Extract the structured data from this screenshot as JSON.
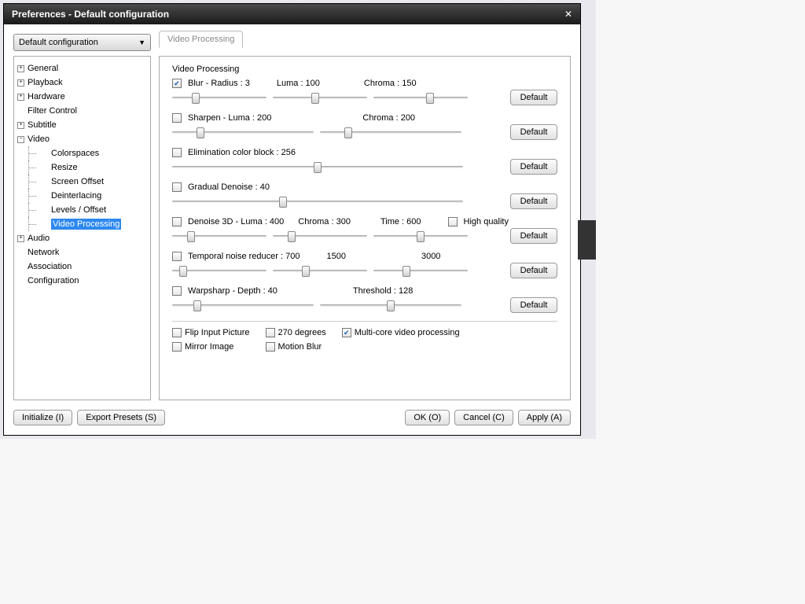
{
  "window_title": "Preferences - Default configuration",
  "combo_value": "Default configuration",
  "active_tab": "Video Processing",
  "tree": {
    "root": [
      {
        "label": "General",
        "kind": "plus"
      },
      {
        "label": "Playback",
        "kind": "plus"
      },
      {
        "label": "Hardware",
        "kind": "plus"
      },
      {
        "label": "Filter Control",
        "kind": "none"
      },
      {
        "label": "Subtitle",
        "kind": "plus"
      },
      {
        "label": "Video",
        "kind": "minus",
        "children": [
          "Colorspaces",
          "Resize",
          "Screen Offset",
          "Deinterlacing",
          "Levels / Offset",
          "Video Processing"
        ]
      },
      {
        "label": "Audio",
        "kind": "plus"
      },
      {
        "label": "Network",
        "kind": "none"
      },
      {
        "label": "Association",
        "kind": "none"
      },
      {
        "label": "Configuration",
        "kind": "none"
      }
    ],
    "selected": "Video Processing"
  },
  "section_title": "Video Processing",
  "default_label": "Default",
  "controls": {
    "blur": {
      "checked": true,
      "label": "Blur - Radius : 3",
      "luma": "Luma : 100",
      "chroma": "Chroma : 150"
    },
    "sharpen": {
      "checked": false,
      "label": "Sharpen - Luma : 200",
      "chroma": "Chroma : 200"
    },
    "elim": {
      "checked": false,
      "label": "Elimination color block : 256"
    },
    "grad": {
      "checked": false,
      "label": "Gradual Denoise : 40"
    },
    "d3d": {
      "checked": false,
      "label": "Denoise 3D - Luma : 400",
      "chroma": "Chroma : 300",
      "time": "Time : 600",
      "hq": "High quality",
      "hq_checked": false
    },
    "tnr": {
      "checked": false,
      "label": "Temporal noise reducer : 700",
      "v2": "1500",
      "v3": "3000"
    },
    "warp": {
      "checked": false,
      "label": "Warpsharp - Depth : 40",
      "thr": "Threshold : 128"
    },
    "flip": {
      "checked": false,
      "label": "Flip Input Picture"
    },
    "mirror": {
      "checked": false,
      "label": "Mirror Image"
    },
    "deg": {
      "checked": false,
      "label": "270 degrees"
    },
    "mblur": {
      "checked": false,
      "label": "Motion Blur"
    },
    "mcore": {
      "checked": true,
      "label": "Multi-core video processing"
    }
  },
  "buttons": {
    "init": "Initialize (I)",
    "export": "Export Presets (S)",
    "ok": "OK (O)",
    "cancel": "Cancel (C)",
    "apply": "Apply (A)"
  }
}
